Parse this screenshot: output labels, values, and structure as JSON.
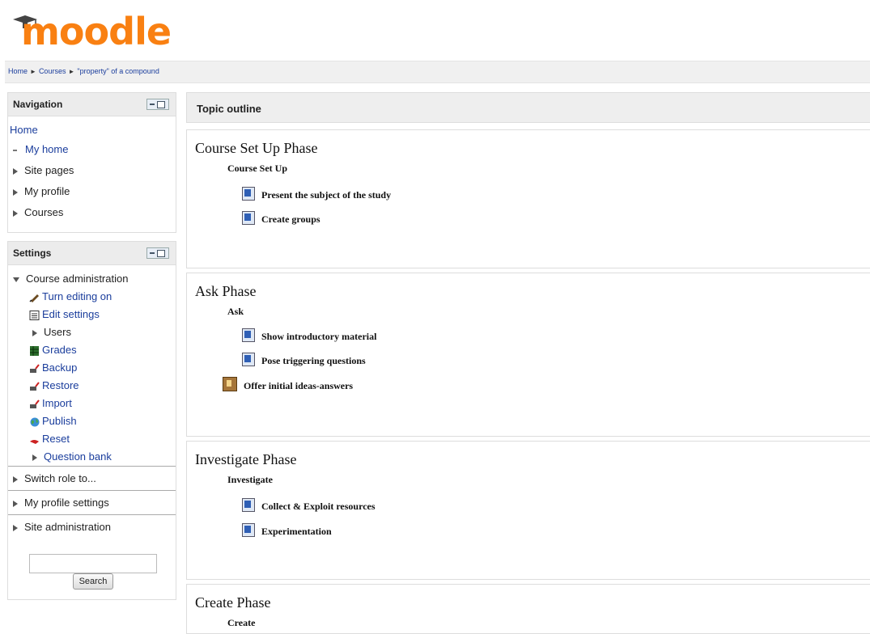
{
  "logo": {
    "text": "moodle"
  },
  "breadcrumb": {
    "items": [
      "Home",
      "Courses",
      "\"property\" of a compound"
    ],
    "separator": "►"
  },
  "navigation": {
    "title": "Navigation",
    "home": "Home",
    "items": [
      {
        "label": "My home",
        "icon": "dot"
      },
      {
        "label": "Site pages",
        "icon": "collapsed-triangle"
      },
      {
        "label": "My profile",
        "icon": "collapsed-triangle"
      },
      {
        "label": "Courses",
        "icon": "collapsed-triangle"
      }
    ]
  },
  "settings": {
    "title": "Settings",
    "course_admin": "Course administration",
    "items": [
      {
        "label": "Turn editing on",
        "icon": "pencil-icon"
      },
      {
        "label": "Edit settings",
        "icon": "settings-doc-icon"
      },
      {
        "label": "Users",
        "icon": "collapsed-triangle"
      },
      {
        "label": "Grades",
        "icon": "grades-icon"
      },
      {
        "label": "Backup",
        "icon": "backup-icon"
      },
      {
        "label": "Restore",
        "icon": "restore-icon"
      },
      {
        "label": "Import",
        "icon": "import-icon"
      },
      {
        "label": "Publish",
        "icon": "globe-icon"
      },
      {
        "label": "Reset",
        "icon": "reset-icon"
      },
      {
        "label": "Question bank",
        "icon": "collapsed-triangle"
      }
    ],
    "switch_role": "Switch role to...",
    "profile_settings": "My profile settings",
    "site_admin": "Site administration",
    "search_button": "Search",
    "search_value": ""
  },
  "topic_outline": {
    "title": "Topic outline"
  },
  "sections": [
    {
      "title": "Course Set Up Phase",
      "label": "Course Set Up",
      "activities": [
        "Present the subject of the study",
        "Create groups"
      ]
    },
    {
      "title": "Ask Phase",
      "label": "Ask",
      "activities": [
        "Show introductory material",
        "Pose triggering questions"
      ],
      "forum": "Offer initial ideas-answers"
    },
    {
      "title": "Investigate Phase",
      "label": "Investigate",
      "activities": [
        "Collect & Exploit resources",
        "Experimentation"
      ]
    },
    {
      "title": "Create Phase",
      "label": "Create"
    }
  ],
  "colors": {
    "logo": "#f98012",
    "link": "#1a3d9c"
  }
}
